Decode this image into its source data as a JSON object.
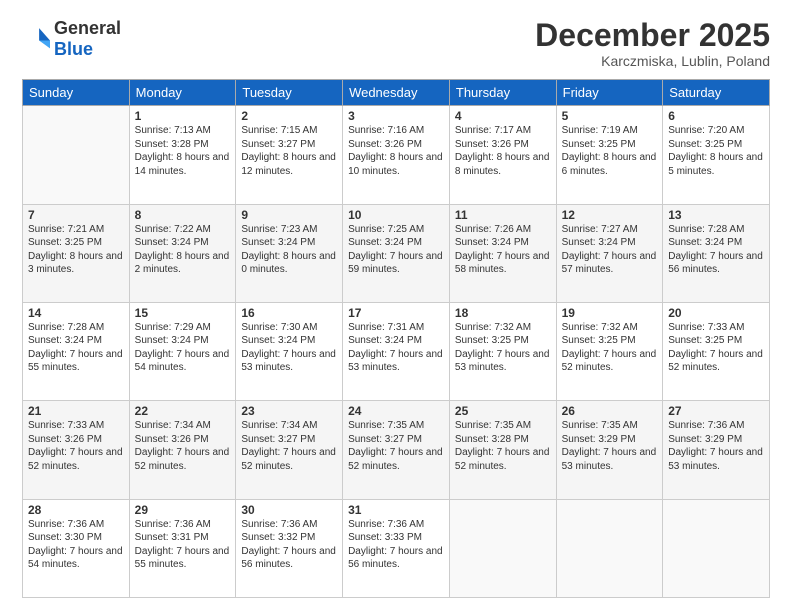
{
  "header": {
    "logo_general": "General",
    "logo_blue": "Blue",
    "month": "December 2025",
    "location": "Karczmiska, Lublin, Poland"
  },
  "days_of_week": [
    "Sunday",
    "Monday",
    "Tuesday",
    "Wednesday",
    "Thursday",
    "Friday",
    "Saturday"
  ],
  "weeks": [
    [
      {
        "day": "",
        "empty": true
      },
      {
        "day": "1",
        "sunrise": "Sunrise: 7:13 AM",
        "sunset": "Sunset: 3:28 PM",
        "daylight": "Daylight: 8 hours and 14 minutes."
      },
      {
        "day": "2",
        "sunrise": "Sunrise: 7:15 AM",
        "sunset": "Sunset: 3:27 PM",
        "daylight": "Daylight: 8 hours and 12 minutes."
      },
      {
        "day": "3",
        "sunrise": "Sunrise: 7:16 AM",
        "sunset": "Sunset: 3:26 PM",
        "daylight": "Daylight: 8 hours and 10 minutes."
      },
      {
        "day": "4",
        "sunrise": "Sunrise: 7:17 AM",
        "sunset": "Sunset: 3:26 PM",
        "daylight": "Daylight: 8 hours and 8 minutes."
      },
      {
        "day": "5",
        "sunrise": "Sunrise: 7:19 AM",
        "sunset": "Sunset: 3:25 PM",
        "daylight": "Daylight: 8 hours and 6 minutes."
      },
      {
        "day": "6",
        "sunrise": "Sunrise: 7:20 AM",
        "sunset": "Sunset: 3:25 PM",
        "daylight": "Daylight: 8 hours and 5 minutes."
      }
    ],
    [
      {
        "day": "7",
        "sunrise": "Sunrise: 7:21 AM",
        "sunset": "Sunset: 3:25 PM",
        "daylight": "Daylight: 8 hours and 3 minutes."
      },
      {
        "day": "8",
        "sunrise": "Sunrise: 7:22 AM",
        "sunset": "Sunset: 3:24 PM",
        "daylight": "Daylight: 8 hours and 2 minutes."
      },
      {
        "day": "9",
        "sunrise": "Sunrise: 7:23 AM",
        "sunset": "Sunset: 3:24 PM",
        "daylight": "Daylight: 8 hours and 0 minutes."
      },
      {
        "day": "10",
        "sunrise": "Sunrise: 7:25 AM",
        "sunset": "Sunset: 3:24 PM",
        "daylight": "Daylight: 7 hours and 59 minutes."
      },
      {
        "day": "11",
        "sunrise": "Sunrise: 7:26 AM",
        "sunset": "Sunset: 3:24 PM",
        "daylight": "Daylight: 7 hours and 58 minutes."
      },
      {
        "day": "12",
        "sunrise": "Sunrise: 7:27 AM",
        "sunset": "Sunset: 3:24 PM",
        "daylight": "Daylight: 7 hours and 57 minutes."
      },
      {
        "day": "13",
        "sunrise": "Sunrise: 7:28 AM",
        "sunset": "Sunset: 3:24 PM",
        "daylight": "Daylight: 7 hours and 56 minutes."
      }
    ],
    [
      {
        "day": "14",
        "sunrise": "Sunrise: 7:28 AM",
        "sunset": "Sunset: 3:24 PM",
        "daylight": "Daylight: 7 hours and 55 minutes."
      },
      {
        "day": "15",
        "sunrise": "Sunrise: 7:29 AM",
        "sunset": "Sunset: 3:24 PM",
        "daylight": "Daylight: 7 hours and 54 minutes."
      },
      {
        "day": "16",
        "sunrise": "Sunrise: 7:30 AM",
        "sunset": "Sunset: 3:24 PM",
        "daylight": "Daylight: 7 hours and 53 minutes."
      },
      {
        "day": "17",
        "sunrise": "Sunrise: 7:31 AM",
        "sunset": "Sunset: 3:24 PM",
        "daylight": "Daylight: 7 hours and 53 minutes."
      },
      {
        "day": "18",
        "sunrise": "Sunrise: 7:32 AM",
        "sunset": "Sunset: 3:25 PM",
        "daylight": "Daylight: 7 hours and 53 minutes."
      },
      {
        "day": "19",
        "sunrise": "Sunrise: 7:32 AM",
        "sunset": "Sunset: 3:25 PM",
        "daylight": "Daylight: 7 hours and 52 minutes."
      },
      {
        "day": "20",
        "sunrise": "Sunrise: 7:33 AM",
        "sunset": "Sunset: 3:25 PM",
        "daylight": "Daylight: 7 hours and 52 minutes."
      }
    ],
    [
      {
        "day": "21",
        "sunrise": "Sunrise: 7:33 AM",
        "sunset": "Sunset: 3:26 PM",
        "daylight": "Daylight: 7 hours and 52 minutes."
      },
      {
        "day": "22",
        "sunrise": "Sunrise: 7:34 AM",
        "sunset": "Sunset: 3:26 PM",
        "daylight": "Daylight: 7 hours and 52 minutes."
      },
      {
        "day": "23",
        "sunrise": "Sunrise: 7:34 AM",
        "sunset": "Sunset: 3:27 PM",
        "daylight": "Daylight: 7 hours and 52 minutes."
      },
      {
        "day": "24",
        "sunrise": "Sunrise: 7:35 AM",
        "sunset": "Sunset: 3:27 PM",
        "daylight": "Daylight: 7 hours and 52 minutes."
      },
      {
        "day": "25",
        "sunrise": "Sunrise: 7:35 AM",
        "sunset": "Sunset: 3:28 PM",
        "daylight": "Daylight: 7 hours and 52 minutes."
      },
      {
        "day": "26",
        "sunrise": "Sunrise: 7:35 AM",
        "sunset": "Sunset: 3:29 PM",
        "daylight": "Daylight: 7 hours and 53 minutes."
      },
      {
        "day": "27",
        "sunrise": "Sunrise: 7:36 AM",
        "sunset": "Sunset: 3:29 PM",
        "daylight": "Daylight: 7 hours and 53 minutes."
      }
    ],
    [
      {
        "day": "28",
        "sunrise": "Sunrise: 7:36 AM",
        "sunset": "Sunset: 3:30 PM",
        "daylight": "Daylight: 7 hours and 54 minutes."
      },
      {
        "day": "29",
        "sunrise": "Sunrise: 7:36 AM",
        "sunset": "Sunset: 3:31 PM",
        "daylight": "Daylight: 7 hours and 55 minutes."
      },
      {
        "day": "30",
        "sunrise": "Sunrise: 7:36 AM",
        "sunset": "Sunset: 3:32 PM",
        "daylight": "Daylight: 7 hours and 56 minutes."
      },
      {
        "day": "31",
        "sunrise": "Sunrise: 7:36 AM",
        "sunset": "Sunset: 3:33 PM",
        "daylight": "Daylight: 7 hours and 56 minutes."
      },
      {
        "day": "",
        "empty": true
      },
      {
        "day": "",
        "empty": true
      },
      {
        "day": "",
        "empty": true
      }
    ]
  ]
}
